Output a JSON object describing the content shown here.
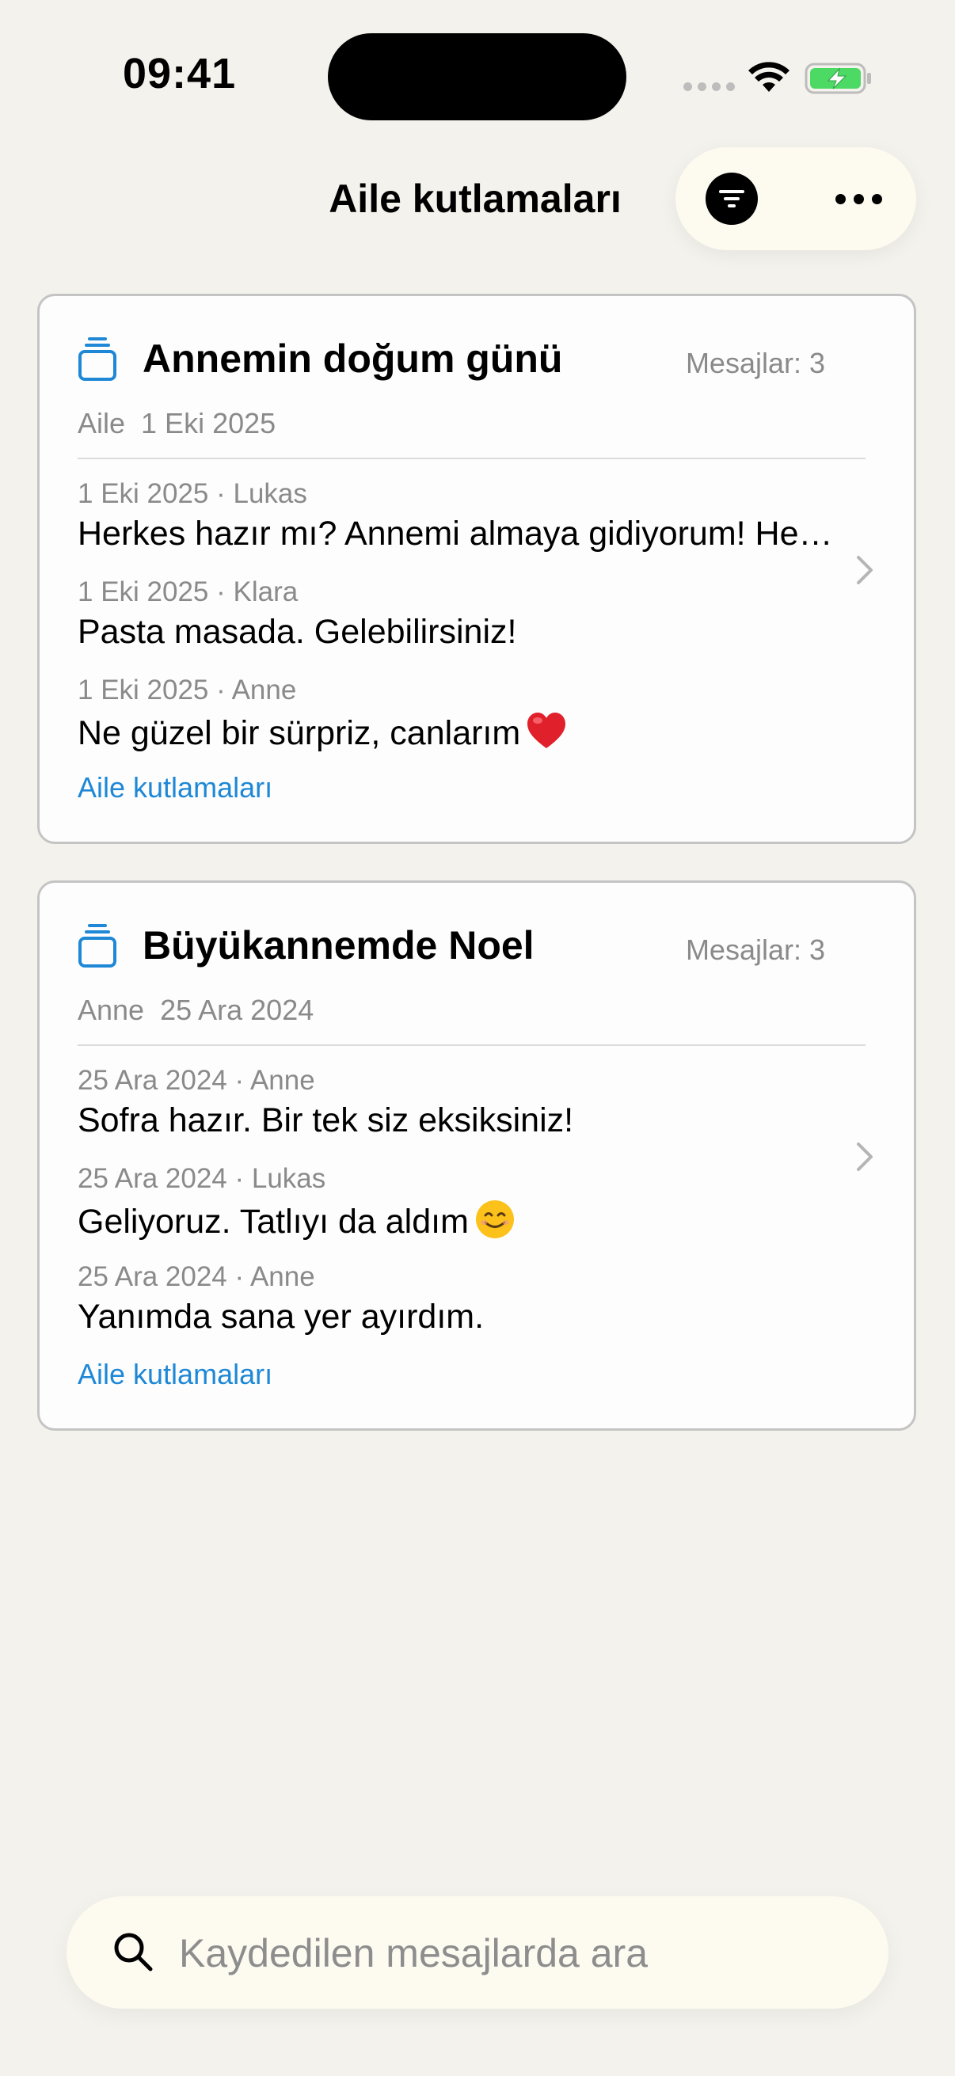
{
  "status_bar": {
    "time": "09:41"
  },
  "nav": {
    "title": "Aile kutlamaları"
  },
  "conversations": [
    {
      "title": "Annemin doğum günü",
      "count_label": "Mesajlar: 3",
      "meta": "Aile  1 Eki 2025",
      "messages": [
        {
          "meta": "1 Eki 2025 · Lukas",
          "text": "Herkes hazır mı? Annemi almaya gidiyorum! Hemen geliyoruz"
        },
        {
          "meta": "1 Eki 2025 · Klara",
          "text": "Pasta masada. Gelebilirsiniz!"
        },
        {
          "meta": "1 Eki 2025 · Anne",
          "text": "Ne güzel bir sürpriz, canlarım",
          "emoji": "red-heart-icon"
        }
      ],
      "tag": "Aile kutlamaları"
    },
    {
      "title": "Büyükannemde Noel",
      "count_label": "Mesajlar: 3",
      "meta": "Anne  25 Ara 2024",
      "messages": [
        {
          "meta": "25 Ara 2024 · Anne",
          "text": "Sofra hazır. Bir tek siz eksiksiniz!"
        },
        {
          "meta": "25 Ara 2024 · Lukas",
          "text": "Geliyoruz. Tatlıyı da aldım",
          "emoji": "smiling-face-icon"
        },
        {
          "meta": "25 Ara 2024 · Anne",
          "text": "Yanımda sana yer ayırdım."
        }
      ],
      "tag": "Aile kutlamaları"
    }
  ],
  "search": {
    "placeholder": "Kaydedilen mesajlarda ara"
  },
  "colors": {
    "accent": "#1e88d6",
    "background": "#f4f2ec",
    "battery": "#4cd964"
  }
}
